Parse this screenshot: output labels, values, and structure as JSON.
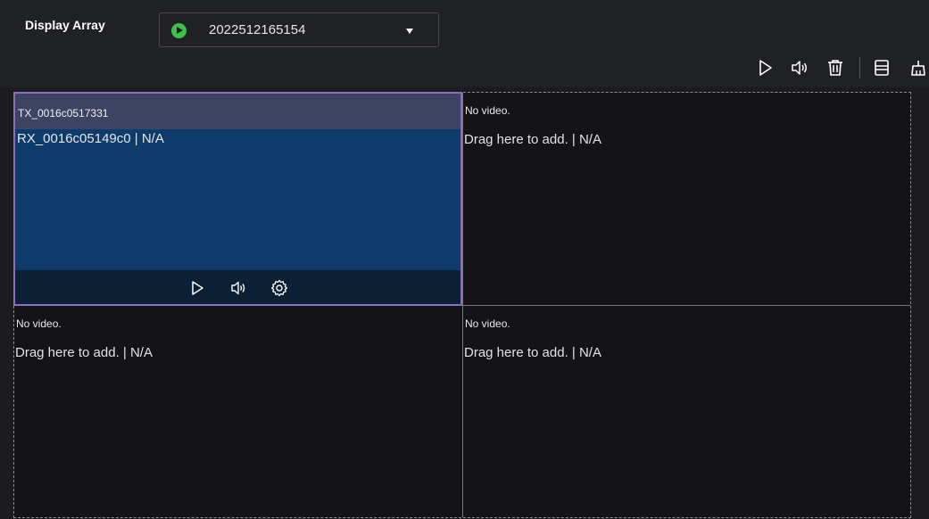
{
  "header": {
    "title": "Display Array",
    "selected_array": "2022512165154"
  },
  "toolbar": {
    "icons": [
      "play-icon",
      "volume-icon",
      "trash-icon",
      "layout-icon",
      "clean-icon"
    ]
  },
  "cells": {
    "active": {
      "tx_label": "TX_0016c0517331",
      "rx_label": "RX_0016c05149c0 | N/A",
      "controls": [
        "play-icon",
        "volume-icon",
        "settings-icon"
      ]
    },
    "top_right": {
      "title": "No video.",
      "sub": "Drag here to add. | N/A"
    },
    "bottom_left": {
      "title": "No video.",
      "sub": "Drag here to add. | N/A"
    },
    "bottom_right": {
      "title": "No video.",
      "sub": "Drag here to add. | N/A"
    }
  },
  "colors": {
    "accent": "#3fc046",
    "active_border": "#8a6fc0",
    "active_bg": "#0d3b6b"
  }
}
